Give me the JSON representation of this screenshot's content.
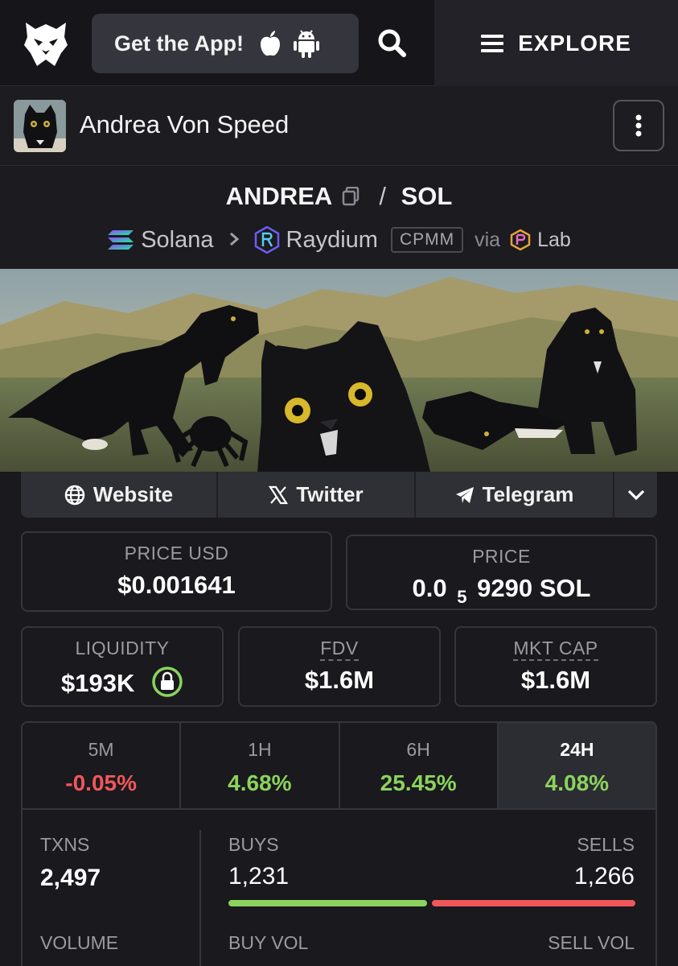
{
  "header": {
    "get_app_label": "Get the App!",
    "explore_label": "EXPLORE"
  },
  "token": {
    "name": "Andrea Von Speed",
    "base": "ANDREA",
    "separator": "/",
    "quote": "SOL",
    "chain": "Solana",
    "dex": "Raydium",
    "pool_type": "CPMM",
    "via_label": "via",
    "launchpad": "Lab"
  },
  "links": {
    "website": "Website",
    "twitter": "Twitter",
    "telegram": "Telegram"
  },
  "metrics": {
    "price_usd_label": "PRICE USD",
    "price_usd": "$0.001641",
    "price_label": "PRICE",
    "price_prefix": "0.0",
    "price_subscript": "5",
    "price_suffix": "9290 SOL",
    "liquidity_label": "LIQUIDITY",
    "liquidity": "$193K",
    "fdv_label": "FDV",
    "fdv": "$1.6M",
    "mktcap_label": "MKT CAP",
    "mktcap": "$1.6M"
  },
  "changes": [
    {
      "period": "5M",
      "value": "-0.05%",
      "direction": "down"
    },
    {
      "period": "1H",
      "value": "4.68%",
      "direction": "up"
    },
    {
      "period": "6H",
      "value": "25.45%",
      "direction": "up"
    },
    {
      "period": "24H",
      "value": "4.08%",
      "direction": "up"
    }
  ],
  "stats": {
    "txns_label": "TXNS",
    "txns": "2,497",
    "buys_label": "BUYS",
    "buys": "1,231",
    "sells_label": "SELLS",
    "sells": "1,266",
    "buys_fraction": 0.493,
    "volume_label": "VOLUME",
    "buy_vol_label": "BUY VOL",
    "sell_vol_label": "SELL VOL"
  },
  "colors": {
    "accent_green": "#8bd35d",
    "accent_red": "#f0575a",
    "lock_ring": "#8bd35d"
  }
}
